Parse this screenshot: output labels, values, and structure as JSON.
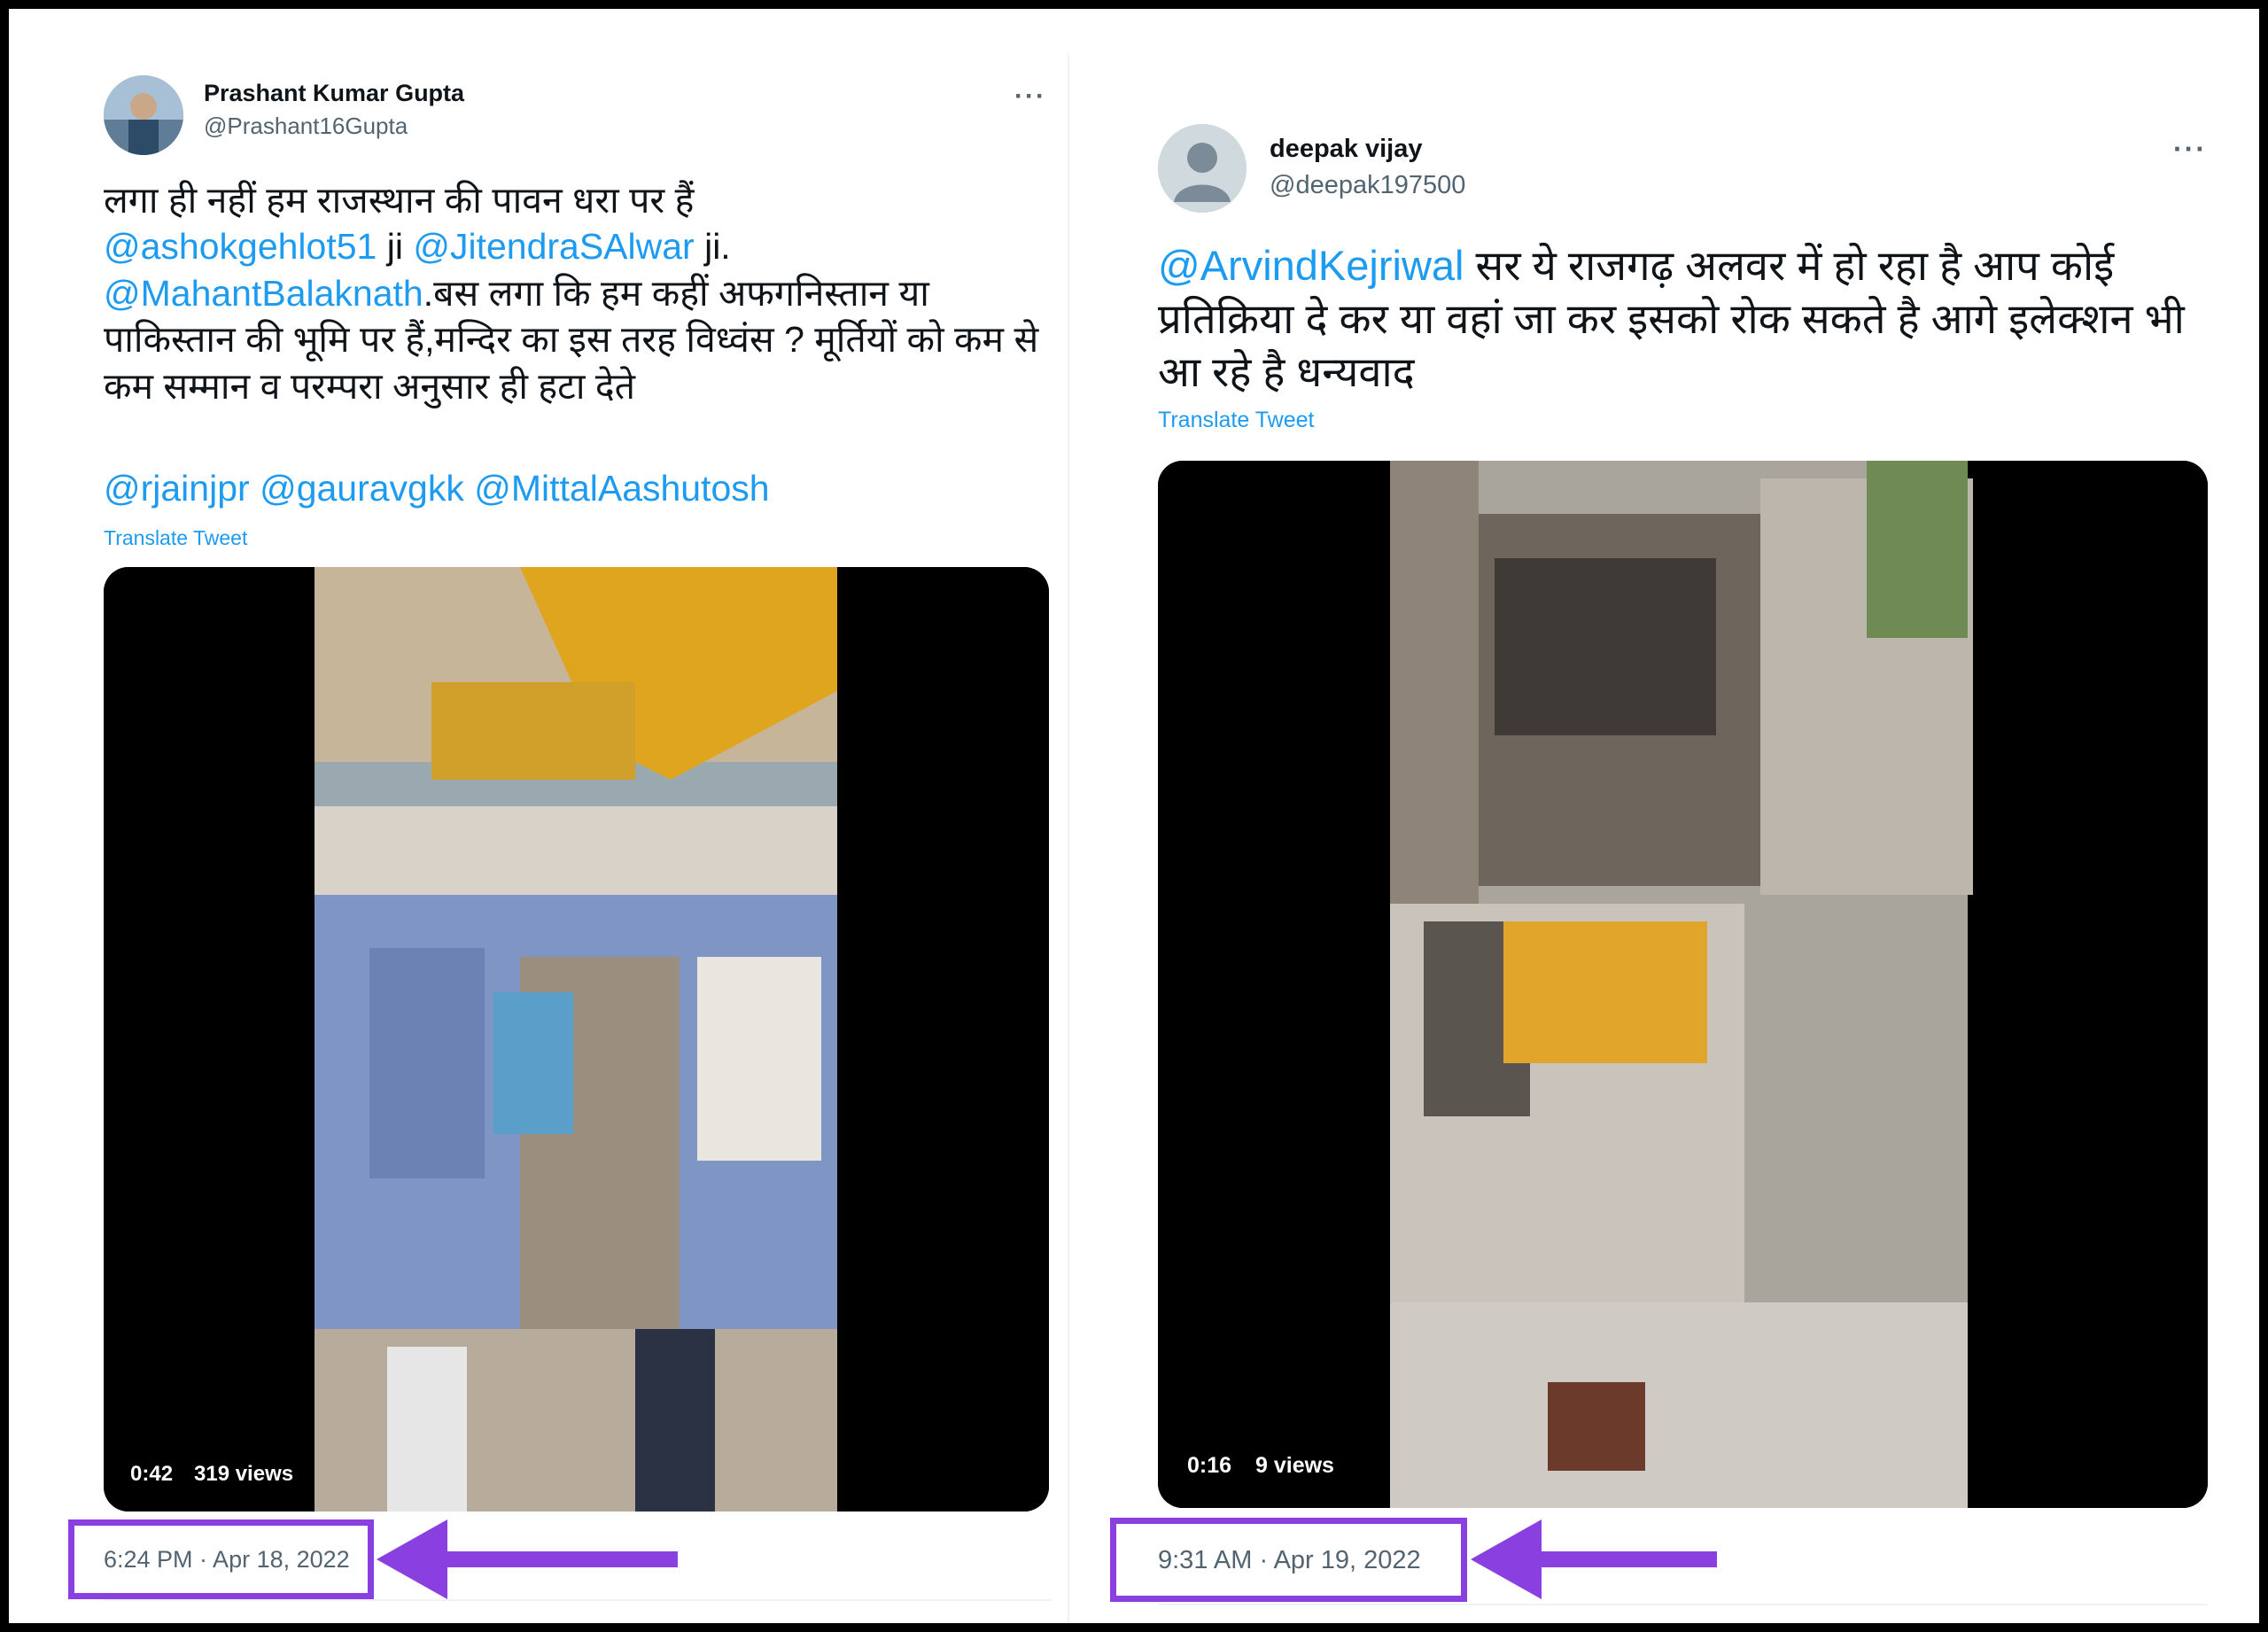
{
  "tweet_left": {
    "author_name": "Prashant Kumar Gupta",
    "author_handle": "@Prashant16Gupta",
    "more_label": "···",
    "text_line1": "लगा ही नहीं हम राजस्थान की पावन धरा पर हैं",
    "mention1": "@ashokgehlot51",
    "text_ji1": " ji ",
    "mention2": "@JitendraSAlwar",
    "text_ji2": " ji.",
    "mention3": "@MahantBalaknath",
    "text_rest": ".बस लगा कि हम कहीं अफगनिस्तान या पाकिस्तान की भूमि पर हैं,मन्दिर का इस तरह विध्वंस ? मूर्तियों को कम से कम सम्मान व परम्परा अनुसार ही हटा देते",
    "mention4": "@rjainjpr",
    "mention5": "@gauravgkk",
    "mention6": "@MittalAashutosh",
    "translate_label": "Translate Tweet",
    "video_duration": "0:42",
    "video_views": "319 views",
    "timestamp": "6:24 PM · Apr 18, 2022"
  },
  "tweet_right": {
    "author_name": "deepak vijay",
    "author_handle": "@deepak197500",
    "more_label": "···",
    "mention1": "@ArvindKejriwal",
    "text_rest": " सर ये राजगढ़  अलवर में हो रहा है आप कोई प्रतिक्रिया दे कर या वहां जा कर इसको रोक सकते है आगे इलेक्शन भी आ रहे है  धन्यवाद",
    "translate_label": "Translate Tweet",
    "video_duration": "0:16",
    "video_views": "9 views",
    "timestamp": "9:31 AM · Apr 19, 2022"
  },
  "colors": {
    "link": "#1d9bf0",
    "highlight": "#8a3fe0",
    "text": "#0f1419",
    "secondary": "#536471"
  },
  "icons": {
    "more": "more-icon",
    "arrow": "arrow-left-icon"
  }
}
